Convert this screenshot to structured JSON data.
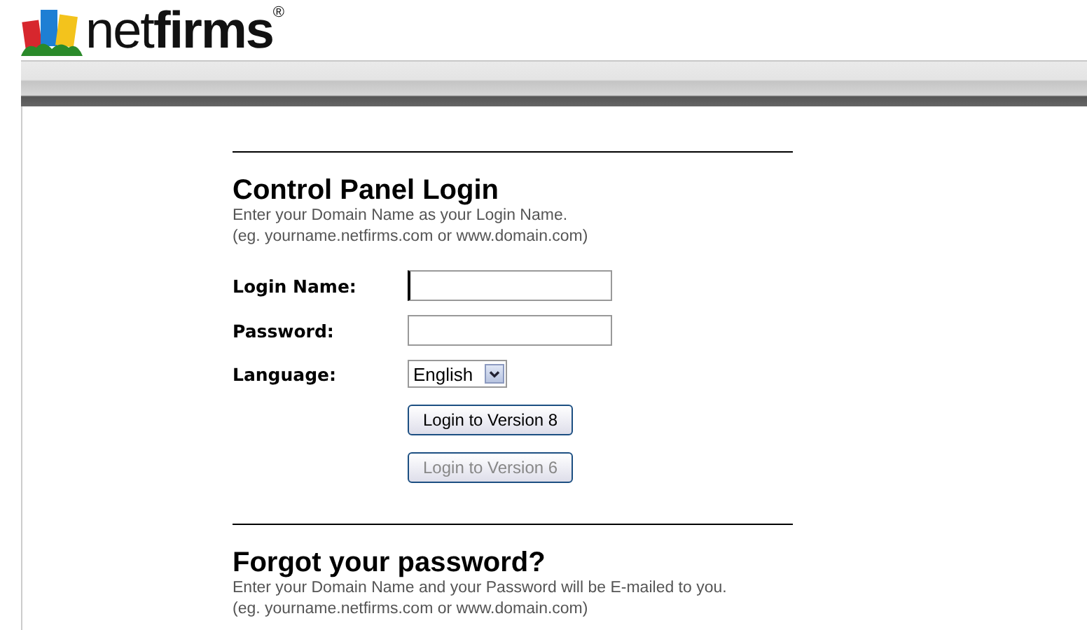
{
  "logo": {
    "text": "net**firms**$^{®}$"
  },
  "login": {
    "title": "Control Panel Login",
    "notes": [
      "Enter your Domain Name as your Login Name.",
      "(eg. yourname.netfirms.com or www.domain.com)"
    ],
    "fields": [
      {
        "kind": "text",
        "label": "Login Name:",
        "focused": true
      },
      {
        "kind": "password",
        "label": "Password:",
        "focused": false
      },
      {
        "kind": "select",
        "label": "Language:",
        "value": "English"
      }
    ],
    "buttons": [
      {
        "label": "Login to Version 8",
        "disabled": false
      },
      {
        "label": "Login to Version 6",
        "disabled": true
      }
    ]
  },
  "forgot": {
    "title": "Forgot your password?",
    "notes": [
      "Enter your Domain Name and your Password will be E-mailed to you.",
      "(eg. yourname.netfirms.com or www.domain.com)"
    ]
  }
}
